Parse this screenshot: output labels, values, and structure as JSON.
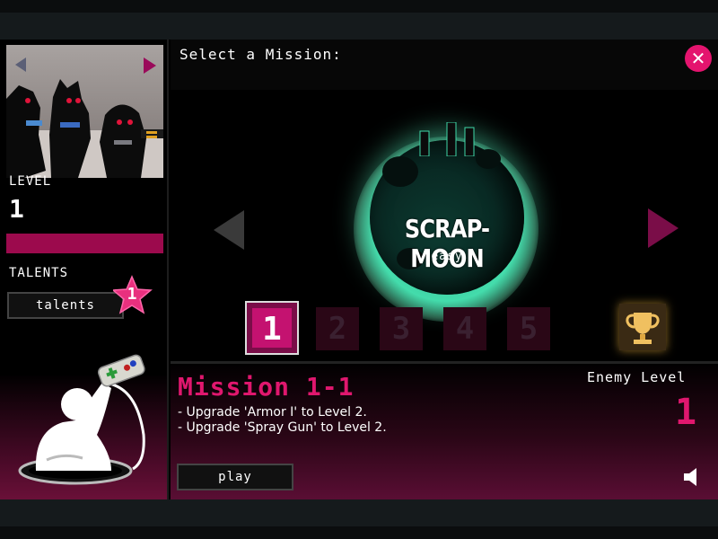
{
  "header": {
    "title": "Select a Mission:",
    "close_glyph": "✕"
  },
  "left_panel": {
    "level_label": "LEVEL",
    "level_value": "1",
    "talents_label": "TALENTS",
    "talents_button": "talents",
    "talents_badge": "1",
    "level_progress": 1.0
  },
  "planet": {
    "name": "SCRAP-MOON",
    "difficulty": "easy"
  },
  "missions": [
    {
      "label": "1",
      "selected": true
    },
    {
      "label": "2",
      "selected": false
    },
    {
      "label": "3",
      "selected": false
    },
    {
      "label": "4",
      "selected": false
    },
    {
      "label": "5",
      "selected": false
    }
  ],
  "mission_info": {
    "title": "Mission 1-1",
    "objectives": [
      "- Upgrade 'Armor I' to Level 2.",
      "- Upgrade 'Spray Gun' to Level 2."
    ],
    "enemy_level_label": "Enemy Level",
    "enemy_level_value": "1",
    "play_button": "play"
  },
  "colors": {
    "accent": "#e0176e",
    "bar": "#9c0a4d",
    "planet_glow": "#3fd8a8"
  },
  "icons": [
    "close-icon",
    "prev-character-icon",
    "next-character-icon",
    "prev-planet-icon",
    "next-planet-icon",
    "star-badge-icon",
    "trophy-icon",
    "speaker-icon",
    "gamer-mascot-icon"
  ]
}
